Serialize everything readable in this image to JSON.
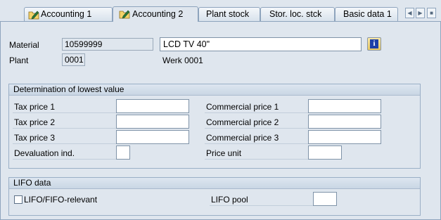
{
  "tabs": [
    {
      "label": "Accounting 1",
      "active": false,
      "icon": "pencil-folder-icon"
    },
    {
      "label": "Accounting 2",
      "active": true,
      "icon": "pencil-folder-icon"
    },
    {
      "label": "Plant stock",
      "active": false
    },
    {
      "label": "Stor. loc. stck",
      "active": false
    },
    {
      "label": "Basic data 1",
      "active": false
    }
  ],
  "header": {
    "material_label": "Material",
    "material_value": "10599999",
    "description_value": "LCD TV 40\"",
    "plant_label": "Plant",
    "plant_value": "0001",
    "plant_name": "Werk 0001"
  },
  "lowest_value": {
    "title": "Determination of lowest value",
    "tax_price_1": "Tax price 1",
    "tax_price_2": "Tax price 2",
    "tax_price_3": "Tax price 3",
    "devaluation": "Devaluation ind.",
    "commercial_price_1": "Commercial price 1",
    "commercial_price_2": "Commercial price 2",
    "commercial_price_3": "Commercial price 3",
    "price_unit": "Price unit"
  },
  "lifo": {
    "title": "LIFO data",
    "relevant_label": "LIFO/FIFO-relevant",
    "relevant_checked": false,
    "pool_label": "LIFO pool"
  },
  "colors": {
    "background": "#dfe6ee",
    "border": "#8ea4bd",
    "info_icon": "#1c3fa8"
  }
}
